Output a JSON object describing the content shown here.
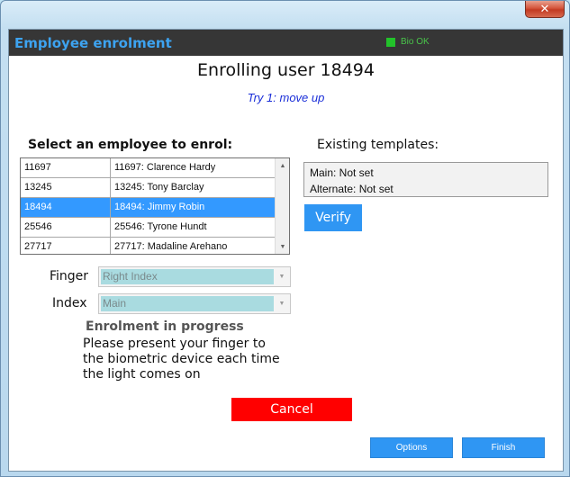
{
  "window": {
    "close_glyph": "✕"
  },
  "titlebar": {
    "app_title": "Employee enrolment",
    "bio_status": "Bio OK",
    "bio_color": "#22c22a"
  },
  "heading": "Enrolling user 18494",
  "try_line": "Try 1: move up",
  "employee_list": {
    "label": "Select an employee to enrol:",
    "rows": [
      {
        "id": "11697",
        "name": "11697: Clarence Hardy",
        "selected": false
      },
      {
        "id": "13245",
        "name": "13245: Tony Barclay",
        "selected": false
      },
      {
        "id": "18494",
        "name": "18494: Jimmy Robin",
        "selected": true
      },
      {
        "id": "25546",
        "name": "25546: Tyrone Hundt",
        "selected": false
      },
      {
        "id": "27717",
        "name": "27717: Madaline Arehano",
        "selected": false
      }
    ],
    "scroll_up_icon": "▲",
    "scroll_down_icon": "▼"
  },
  "finger": {
    "label": "Finger",
    "value": "Right Index",
    "arrow": "▼"
  },
  "index": {
    "label": "Index",
    "value": "Main",
    "arrow": "▼"
  },
  "progress": {
    "title": "Enrolment in progress",
    "instructions": "Please present your finger to the biometric device each time the light comes on"
  },
  "buttons": {
    "cancel": "Cancel",
    "verify": "Verify",
    "options": "Options",
    "finish": "Finish"
  },
  "templates": {
    "label": "Existing templates:",
    "main": "Main: Not set",
    "alternate": "Alternate: Not set"
  },
  "colors": {
    "title_accent": "#3da3f0",
    "selected_row": "#3399ff",
    "cancel": "#ff0000",
    "primary_button": "#2f96f3"
  }
}
